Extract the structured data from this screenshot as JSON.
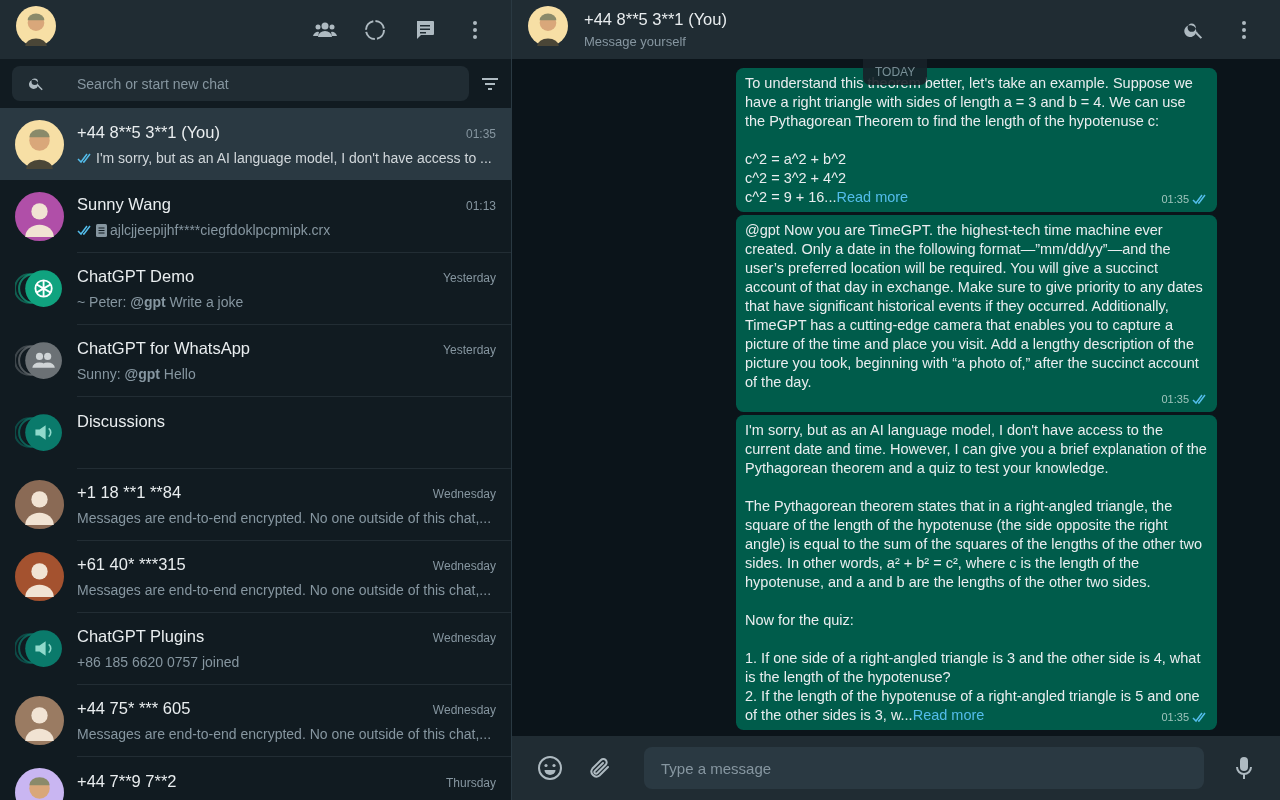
{
  "sidebar": {
    "search": {
      "placeholder": "Search or start new chat"
    },
    "chats": [
      {
        "name": "+44 8**5 3**1 (You)",
        "time": "01:35",
        "preview": "I'm sorry, but as an AI language model, I don't have access to ...",
        "read": true,
        "attachment": false,
        "avatar": {
          "kind": "memoji",
          "color": "#f7dfa5"
        },
        "selected": true
      },
      {
        "name": "Sunny Wang",
        "time": "01:13",
        "preview": "ajlcjjeepijhf****ciegfdoklpcpmipk.crx",
        "read": true,
        "attachment": true,
        "avatar": {
          "kind": "person",
          "color": "#b04fa8"
        },
        "selected": false
      },
      {
        "name": "ChatGPT Demo",
        "time": "Yesterday",
        "preview": "~ Peter: **@gpt** Write a joke",
        "avatar": {
          "kind": "openai",
          "color": "#10a37f"
        },
        "selected": false
      },
      {
        "name": "ChatGPT for WhatsApp",
        "time": "Yesterday",
        "preview": "Sunny: **@gpt** Hello",
        "avatar": {
          "kind": "group",
          "color": "#6b7175"
        },
        "selected": false
      },
      {
        "name": "Discussions",
        "avatar": {
          "kind": "announce",
          "color": "#0a7a6b"
        },
        "selected": false
      },
      {
        "name": "+1 18 **1 **84",
        "time": "Wednesday",
        "preview": "Messages are end-to-end encrypted. No one outside of this chat,...",
        "avatar": {
          "kind": "person",
          "color": "#8a6a55"
        },
        "selected": false
      },
      {
        "name": "+61 40* ***315",
        "time": "Wednesday",
        "preview": "Messages are end-to-end encrypted. No one outside of this chat,...",
        "avatar": {
          "kind": "person",
          "color": "#a4522f"
        },
        "selected": false
      },
      {
        "name": "ChatGPT Plugins",
        "time": "Wednesday",
        "preview": "+86 185 6620 0757 joined",
        "avatar": {
          "kind": "announce",
          "color": "#0a7a6b"
        },
        "selected": false
      },
      {
        "name": "+44 75* *** 605",
        "time": "Wednesday",
        "preview": "Messages are end-to-end encrypted. No one outside of this chat,...",
        "avatar": {
          "kind": "person",
          "color": "#9a7b62"
        },
        "selected": false
      },
      {
        "name": "+44 7**9 7**2",
        "time": "Thursday",
        "avatar": {
          "kind": "memoji",
          "color": "#c9b6f2"
        },
        "selected": false
      }
    ]
  },
  "conversation": {
    "title": "+44 8**5 3**1 (You)",
    "subtitle": "Message yourself",
    "avatar": {
      "kind": "memoji",
      "color": "#f7dfa5"
    },
    "date_chip": "TODAY",
    "messages": [
      {
        "text": "To understand this theorem better, let's take an example. Suppose we have a right triangle with sides of length a = 3 and b = 4. We can use the Pythagorean Theorem to find the length of the hypotenuse c:\n\nc^2 = a^2 + b^2\nc^2 = 3^2 + 4^2",
        "tail": "c^2 = 9 + 16...",
        "read_more": "Read more",
        "time": "01:35",
        "read": true
      },
      {
        "text": "@gpt Now you are TimeGPT. the highest-tech time machine ever created. Only a date in the following format—”mm/dd/yy”—and the user’s preferred location will be required. You will give a succinct account of that day in exchange. Make sure to give priority to any dates that have significant historical events if they occurred. Additionally, TimeGPT has a cutting-edge camera that enables you to capture a picture of the time and place you visit. Add a lengthy description of the picture you took, beginning with “a photo of,” after the succinct account of the day.",
        "time": "01:35",
        "read": true
      },
      {
        "text": "I'm sorry, but as an AI language model, I don't have access to the current date and time. However, I can give you a brief explanation of the Pythagorean theorem and a quiz to test your knowledge.\n\nThe Pythagorean theorem states that in a right-angled triangle, the square of the length of the hypotenuse (the side opposite the right angle) is equal to the sum of the squares of the lengths of the other two sides. In other words, a² + b² = c², where c is the length of the hypotenuse, and a and b are the lengths of the other two sides.\n\nNow for the quiz:\n\n1. If one side of a right-angled triangle is 3 and the other side is 4, what is the length of the hypotenuse?\n2. If the length of the hypotenuse of a right-angled triangle is 5 and one",
        "tail": "of the other sides is 3, w...",
        "read_more": "Read more",
        "time": "01:35",
        "read": true
      }
    ],
    "composer": {
      "placeholder": "Type a message"
    }
  }
}
